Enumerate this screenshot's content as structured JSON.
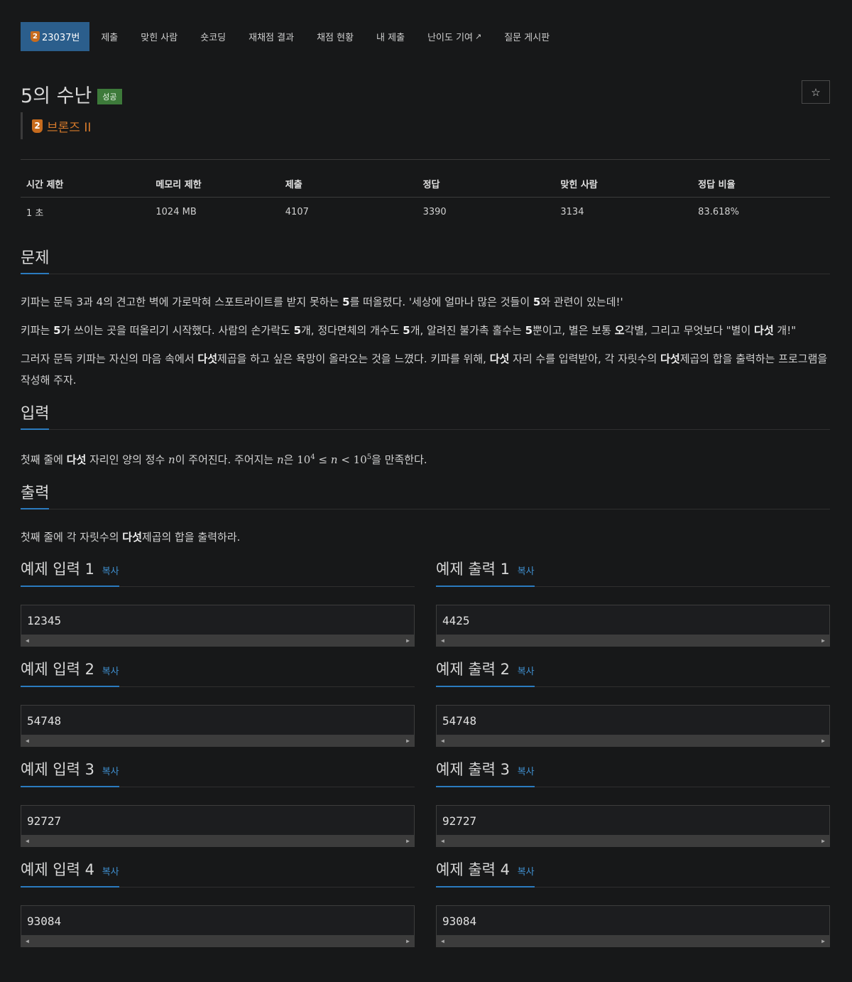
{
  "tabs": [
    {
      "label": "23037번",
      "tier": "2",
      "active": true
    },
    {
      "label": "제출"
    },
    {
      "label": "맞힌 사람"
    },
    {
      "label": "숏코딩"
    },
    {
      "label": "재채점 결과"
    },
    {
      "label": "채점 현황"
    },
    {
      "label": "내 제출"
    },
    {
      "label": "난이도 기여",
      "external": true
    },
    {
      "label": "질문 게시판"
    }
  ],
  "problem": {
    "title": "5의 수난",
    "status": "성공",
    "tier_number": "2",
    "tier_name": "브론즈 II",
    "star": "☆"
  },
  "info": {
    "headers": [
      "시간 제한",
      "메모리 제한",
      "제출",
      "정답",
      "맞힌 사람",
      "정답 비율"
    ],
    "values": [
      "1 초",
      "1024 MB",
      "4107",
      "3390",
      "3134",
      "83.618%"
    ]
  },
  "sections": {
    "problem_title": "문제",
    "input_title": "입력",
    "output_title": "출력"
  },
  "problem_text": {
    "p1": [
      "키파는 문득 3과 4의 견고한 벽에 가로막혀 스포트라이트를 받지 못하는 ",
      "5",
      "를 떠올렸다. '세상에 얼마나 많은 것들이 ",
      "5",
      "와 관련이 있는데!'"
    ],
    "p2": [
      "키파는 ",
      "5",
      "가 쓰이는 곳을 떠올리기 시작했다. 사람의 손가락도 ",
      "5",
      "개, 정다면체의 개수도 ",
      "5",
      "개, 알려진 불가촉 홀수는 ",
      "5",
      "뿐이고, 별은 보통 ",
      "오",
      "각별, 그리고 무엇보다 \"별이 ",
      "다섯",
      " 개!\""
    ],
    "p3": [
      "그러자 문득 키파는 자신의 마음 속에서 ",
      "다섯",
      "제곱을 하고 싶은 욕망이 올라오는 것을 느꼈다. 키파를 위해, ",
      "다섯",
      " 자리 수를 입력받아, 각 자릿수의 ",
      "다섯",
      "제곱의 합을 출력하는 프로그램을 작성해 주자."
    ]
  },
  "input_text": {
    "a": "첫째 줄에 ",
    "b": "다섯",
    "c": " 자리인 양의 정수 ",
    "n1": "n",
    "d": "이 주어진다. 주어지는 ",
    "n2": "n",
    "e": "은 ",
    "ten1": "10",
    "exp1": "4",
    "le": "≤",
    "n3": "n",
    "lt": "<",
    "ten2": "10",
    "exp2": "5",
    "f": "을 만족한다."
  },
  "output_text": {
    "a": "첫째 줄에 각 자릿수의 ",
    "b": "다섯",
    "c": "제곱의 합을 출력하라."
  },
  "copy_label": "복사",
  "samples": [
    {
      "in_label": "예제 입력 1",
      "in": "12345",
      "out_label": "예제 출력 1",
      "out": "4425"
    },
    {
      "in_label": "예제 입력 2",
      "in": "54748",
      "out_label": "예제 출력 2",
      "out": "54748"
    },
    {
      "in_label": "예제 입력 3",
      "in": "92727",
      "out_label": "예제 출력 3",
      "out": "92727"
    },
    {
      "in_label": "예제 입력 4",
      "in": "93084",
      "out_label": "예제 출력 4",
      "out": "93084"
    }
  ],
  "colors": {
    "background": "#171819",
    "active_tab": "#2b5e8c",
    "accent_underline": "#2b7bbf",
    "success_badge": "#3d7a3a",
    "bronze": "#c66b1e",
    "copy_link": "#3f8fd0"
  }
}
